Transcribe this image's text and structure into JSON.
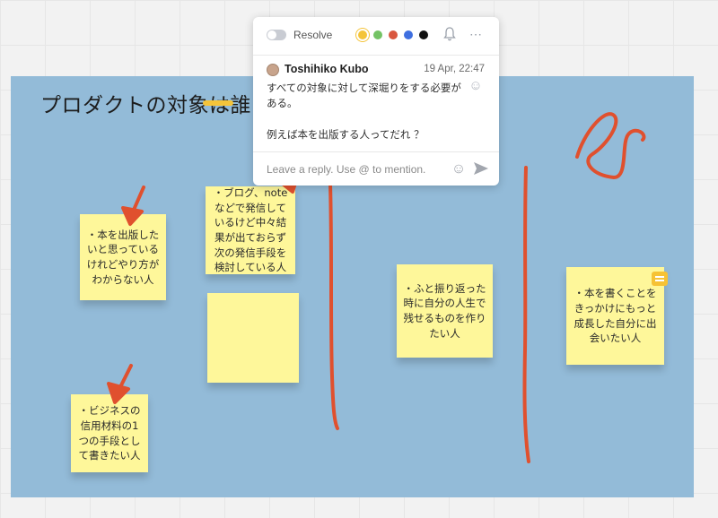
{
  "board": {
    "frame_title": "プロダクトの対象は誰",
    "stickies": [
      {
        "id": "s1",
        "text": "・本を出版したいと思っているけれどやり方がわからない人"
      },
      {
        "id": "s2",
        "text": "・ブログ、noteなどで発信しているけど中々結果が出ておらず次の発信手段を検討している人"
      },
      {
        "id": "s3",
        "text": "・ふと振り返った時に自分の人生で残せるものを作りたい人"
      },
      {
        "id": "s4",
        "text": "・本を書くことをきっかけにもっと成長した自分に出会いたい人"
      },
      {
        "id": "s5",
        "text": "・ビジネスの信用材料の1つの手段として書きたい人"
      },
      {
        "id": "s6",
        "text": ""
      }
    ]
  },
  "comment_popup": {
    "resolve_label": "Resolve",
    "colors": [
      {
        "name": "yellow",
        "hex": "#f4c43a",
        "selected": true
      },
      {
        "name": "green",
        "hex": "#74c365"
      },
      {
        "name": "red",
        "hex": "#d9573f"
      },
      {
        "name": "blue",
        "hex": "#3f6fe0"
      },
      {
        "name": "black",
        "hex": "#111111"
      }
    ],
    "bell_icon": "bell-icon",
    "more_icon": "more-icon",
    "author": "Toshihiko Kubo",
    "timestamp": "19 Apr, 22:47",
    "body": "すべての対象に対して深堀りをする必要がある。\n\n例えば本を出版する人ってだれ ？",
    "reply_placeholder": "Leave a reply. Use @ to mention."
  },
  "accent_colors": {
    "frame": "#93bbd8",
    "sticky": "#fef79a",
    "ink": "#e0502e"
  }
}
